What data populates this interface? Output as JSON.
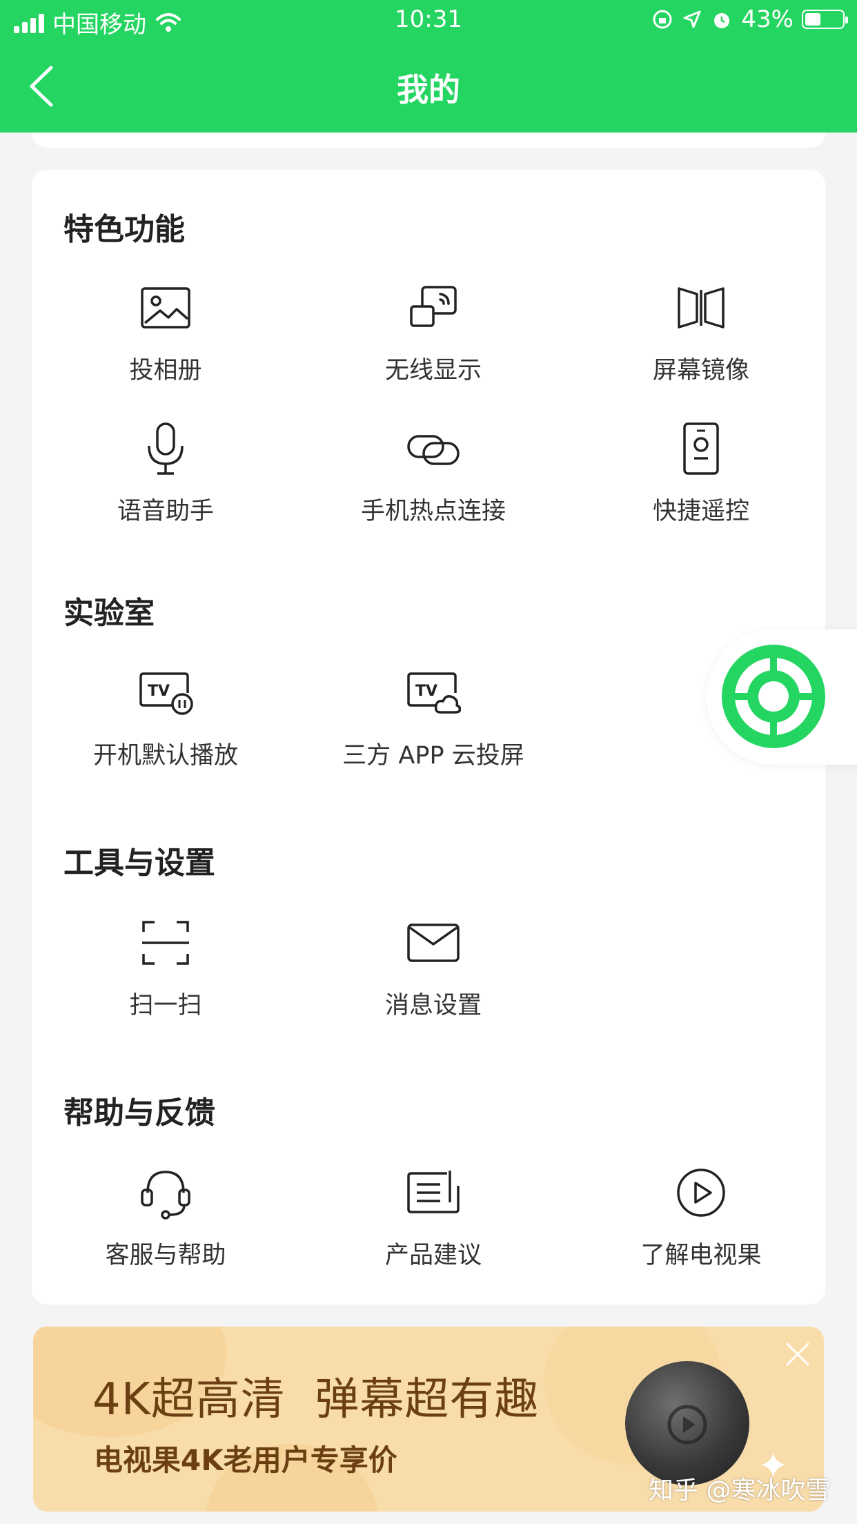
{
  "status_bar": {
    "carrier": "中国移动",
    "time": "10:31",
    "battery": "43%",
    "battery_level": 0.43
  },
  "nav": {
    "title": "我的"
  },
  "sections": {
    "features": {
      "title": "特色功能",
      "items": [
        {
          "label": "投相册",
          "icon": "photo-icon"
        },
        {
          "label": "无线显示",
          "icon": "wireless-display-icon"
        },
        {
          "label": "屏幕镜像",
          "icon": "screen-mirror-icon"
        },
        {
          "label": "语音助手",
          "icon": "microphone-icon"
        },
        {
          "label": "手机热点连接",
          "icon": "link-icon"
        },
        {
          "label": "快捷遥控",
          "icon": "remote-icon"
        }
      ]
    },
    "lab": {
      "title": "实验室",
      "items": [
        {
          "label": "开机默认播放",
          "icon": "tv-pause-icon",
          "icon_text": "TV"
        },
        {
          "label": "三方 APP 云投屏",
          "icon": "tv-cloud-icon",
          "icon_text": "TV"
        }
      ]
    },
    "tools": {
      "title": "工具与设置",
      "items": [
        {
          "label": "扫一扫",
          "icon": "scan-icon"
        },
        {
          "label": "消息设置",
          "icon": "mail-icon"
        }
      ]
    },
    "help": {
      "title": "帮助与反馈",
      "items": [
        {
          "label": "客服与帮助",
          "icon": "headset-icon"
        },
        {
          "label": "产品建议",
          "icon": "feedback-icon"
        },
        {
          "label": "了解电视果",
          "icon": "play-circle-icon"
        }
      ]
    }
  },
  "banner": {
    "headline": "4K超高清  弹幕超有趣",
    "subline": "电视果4K老用户专享价"
  },
  "watermark": "知乎 @寒冰吹雪",
  "colors": {
    "brand_green": "#25d561",
    "banner_bg": "#f8dcaa",
    "banner_text": "#6b3f12"
  }
}
